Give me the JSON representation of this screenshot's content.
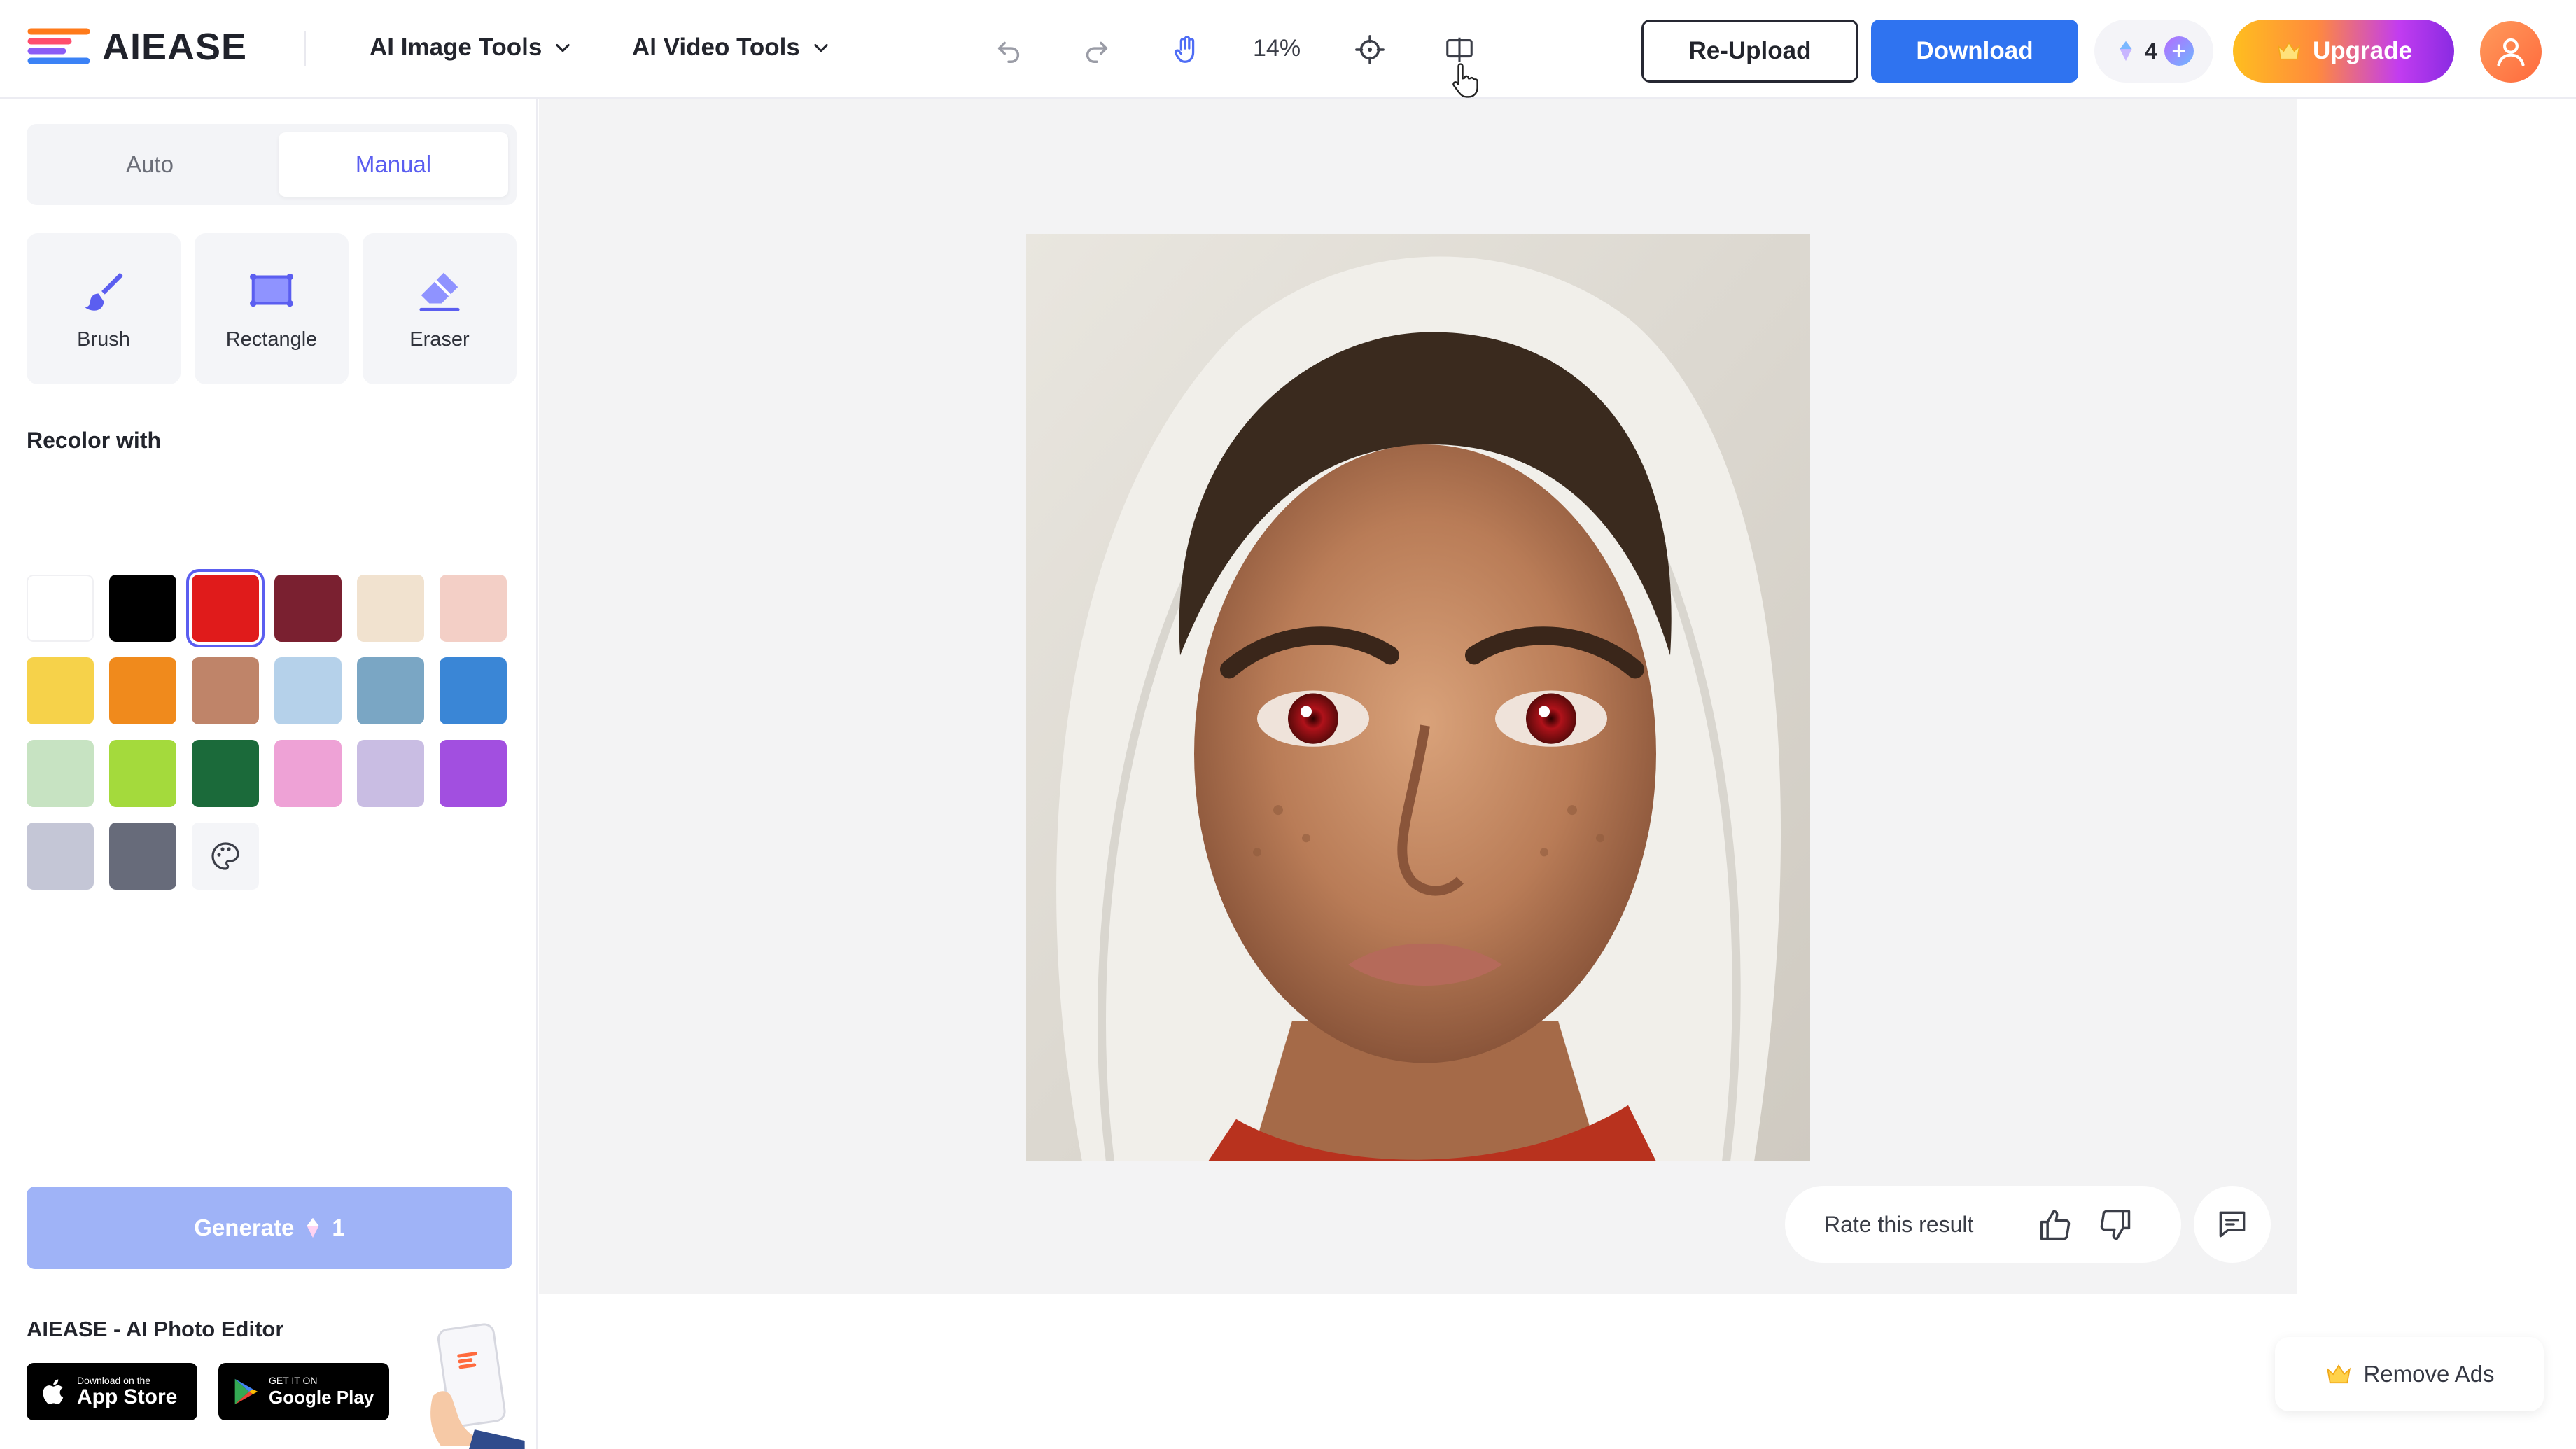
{
  "app": {
    "brand": "AIEASE"
  },
  "nav": {
    "image_tools": "AI Image Tools",
    "video_tools": "AI Video Tools"
  },
  "toolbar": {
    "zoom": "14%",
    "reupload_label": "Re-Upload",
    "download_label": "Download",
    "credits": "4",
    "upgrade_label": "Upgrade"
  },
  "mode": {
    "auto": "Auto",
    "manual": "Manual",
    "selected": "Manual"
  },
  "tools": [
    {
      "label": "Brush"
    },
    {
      "label": "Rectangle"
    },
    {
      "label": "Eraser"
    }
  ],
  "recolor": {
    "title": "Recolor with",
    "selected": "#e01b1b",
    "colors": [
      "#ffffff",
      "#000000",
      "#e01b1b",
      "#7a2030",
      "#f1e2cf",
      "#f3cfc6",
      "#f6d24a",
      "#f08a1c",
      "#bf8469",
      "#b5d1ea",
      "#7aa6c4",
      "#3a86d6",
      "#c7e3c2",
      "#a4da3c",
      "#1b6a3a",
      "#eea2d6",
      "#c9bde3",
      "#a24fe0",
      "#c4c6d6",
      "#676b7a"
    ]
  },
  "generate": {
    "label": "Generate",
    "cost": "1"
  },
  "footer": {
    "app_title": "AIEASE - AI Photo Editor",
    "appstore_small": "Download on the",
    "appstore_big": "App Store",
    "googleplay_small": "GET IT ON",
    "googleplay_big": "Google Play"
  },
  "result": {
    "rate_label": "Rate this result"
  },
  "ads": {
    "remove_label": "Remove Ads"
  },
  "colors": {
    "accent": "#5b5ef0",
    "primary": "#2f73f0"
  }
}
